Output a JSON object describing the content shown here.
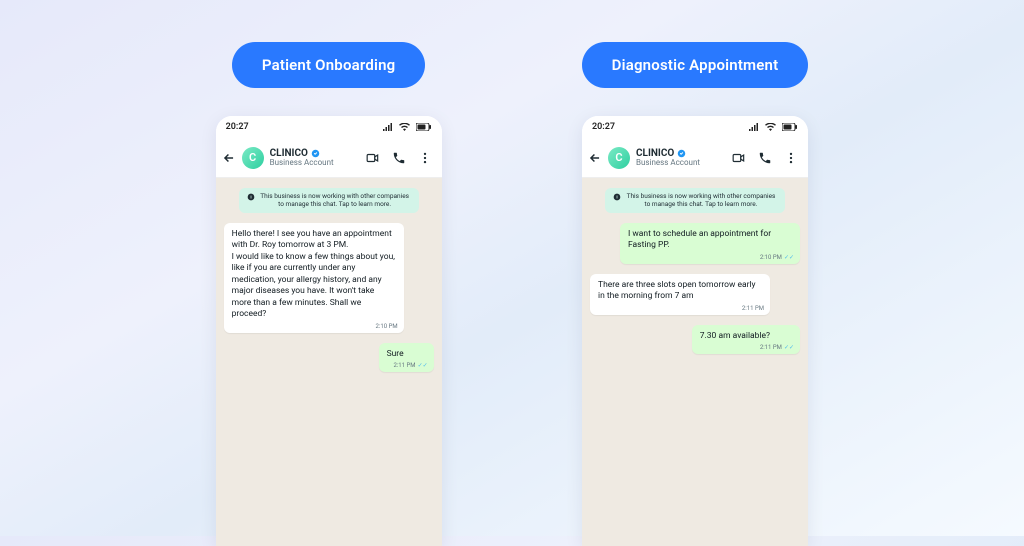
{
  "panels": [
    {
      "pill": "Patient Onboarding"
    },
    {
      "pill": "Diagnostic Appointment"
    }
  ],
  "status": {
    "time": "20:27"
  },
  "contact": {
    "name": "CLINICO",
    "subtitle": "Business Account",
    "avatar_letter": "C"
  },
  "notice": "This business is now working with other companies to manage this chat. Tap to learn more.",
  "chat_onboarding": {
    "in1": "Hello there! I see you have an appointment with Dr. Roy tomorrow at 3 PM.\nI would like to know a few things about you, like if you are currently under any medication, your allergy history, and any major diseases you have. It won't take more than a few minutes. Shall we proceed?",
    "out1": "Sure",
    "t1": "2:10 PM",
    "t2": "2:11 PM"
  },
  "chat_diag": {
    "out1": "I want to schedule an appointment for Fasting PP.",
    "in1": "There are three slots open tomorrow early in the morning from 7 am",
    "out2": "7.30 am available?",
    "t1": "2:10 PM",
    "t2": "2:11 PM",
    "t3": "2:11 PM"
  }
}
